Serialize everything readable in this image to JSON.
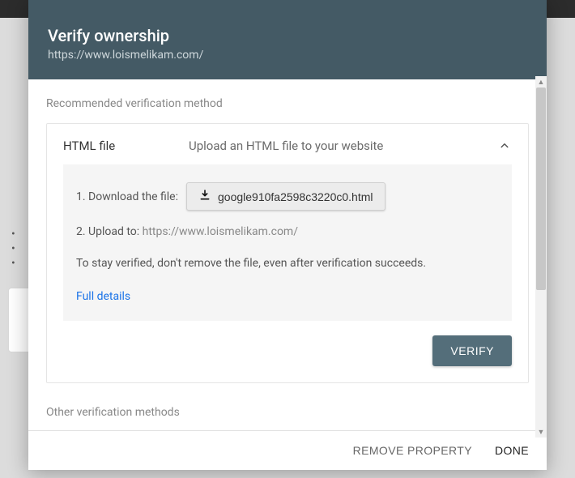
{
  "header": {
    "title": "Verify ownership",
    "site_url": "https://www.loismelikam.com/"
  },
  "body": {
    "recommended_label": "Recommended verification method",
    "method": {
      "name": "HTML file",
      "description": "Upload an HTML file to your website",
      "step1_label": "1. Download the file:",
      "download_filename": "google910fa2598c3220c0.html",
      "step2_prefix": "2. Upload to: ",
      "step2_url": "https://www.loismelikam.com/",
      "persist_note": "To stay verified, don't remove the file, even after verification succeeds.",
      "full_details_label": "Full details",
      "verify_label": "VERIFY"
    },
    "other_label": "Other verification methods"
  },
  "footer": {
    "remove_label": "REMOVE PROPERTY",
    "done_label": "DONE"
  }
}
